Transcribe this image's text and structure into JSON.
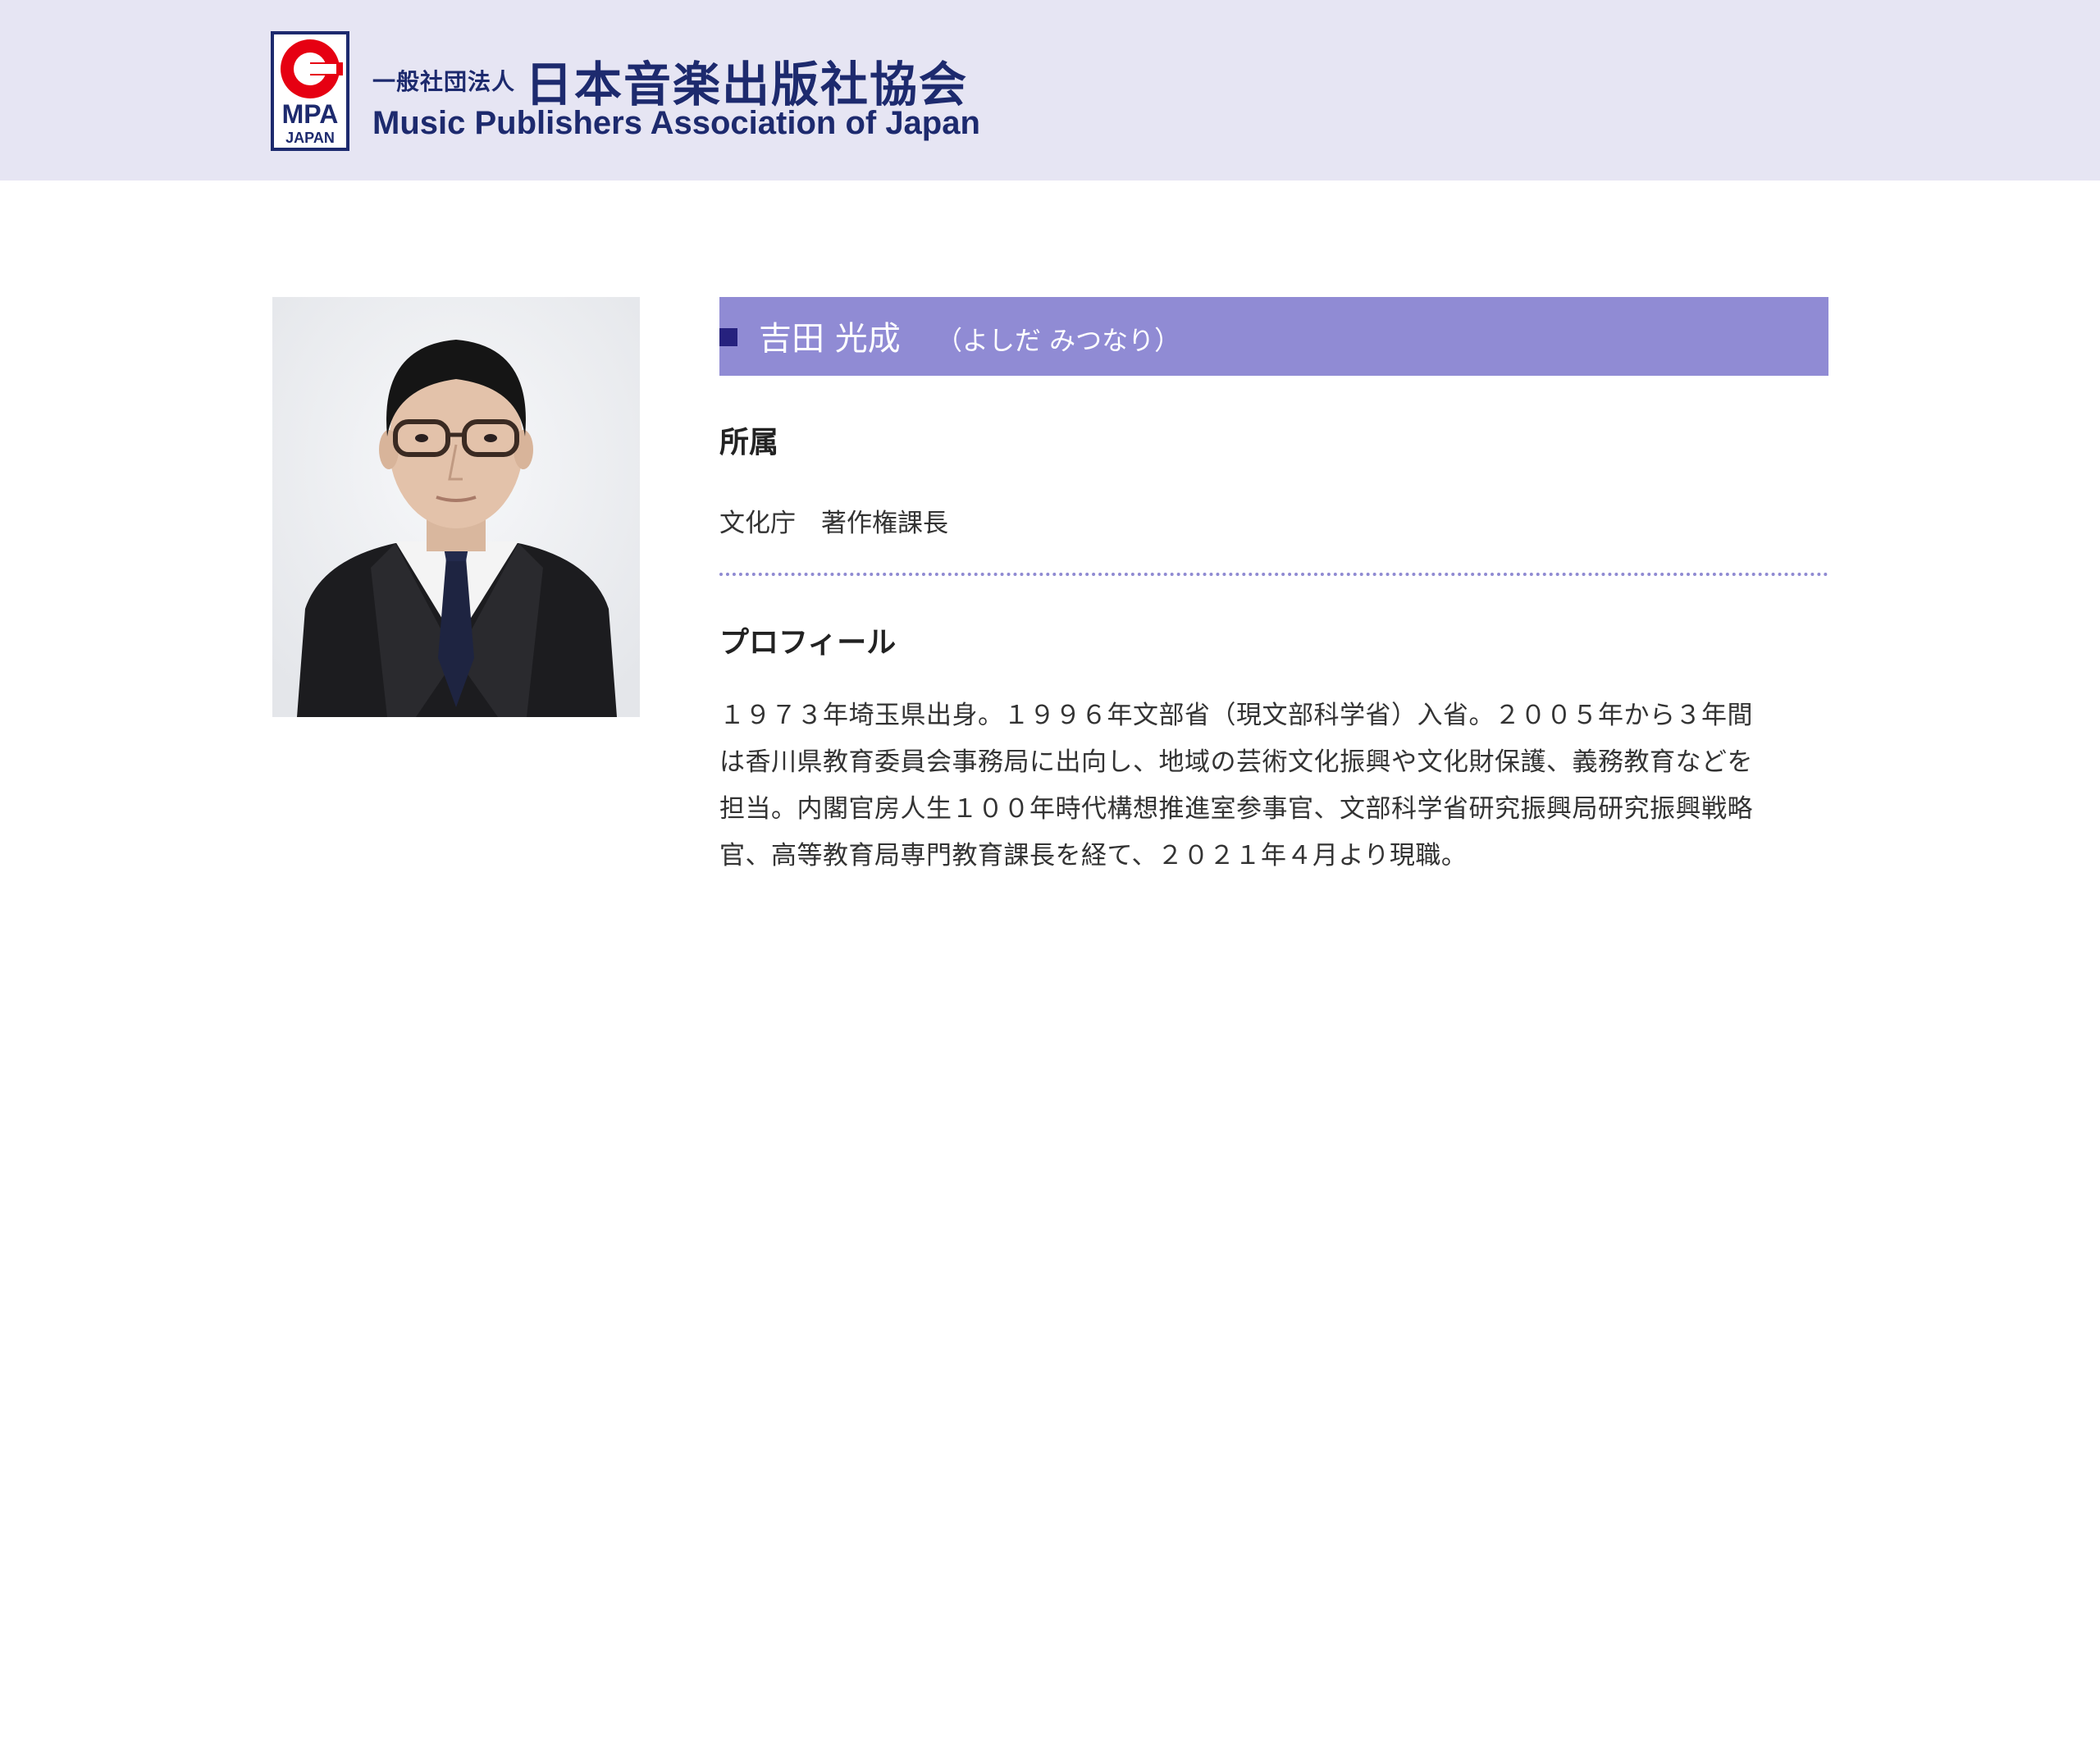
{
  "header": {
    "logo_mark": {
      "top_letter": "C",
      "brand": "MPA",
      "sub": "JAPAN"
    },
    "org_type": "一般社団法人",
    "org_name_jp": "日本音楽出版社協会",
    "org_name_en": "Music Publishers Association of Japan"
  },
  "profile": {
    "name": "吉田 光成",
    "reading": "（よしだ みつなり）",
    "affiliation_label": "所属",
    "affiliation_value": "文化庁　著作権課長",
    "profile_label": "プロフィール",
    "profile_lines": [
      "１９７３年埼玉県出身。１９９６年文部省（現文部科学省）入省。２００５年から３年間",
      "は香川県教育委員会事務局に出向し、地域の芸術文化振興や文化財保護、義務教育などを",
      "担当。内閣官房人生１００年時代構想推進室参事官、文部科学省研究振興局研究振興戦略",
      "官、高等教育局専門教育課長を経て、２０２１年４月より現職。"
    ]
  },
  "colors": {
    "header_bg": "#e6e5f3",
    "brand_navy": "#1d2a6e",
    "logo_red": "#e60012",
    "name_bar": "#908bd4",
    "name_marker": "#26217e"
  }
}
